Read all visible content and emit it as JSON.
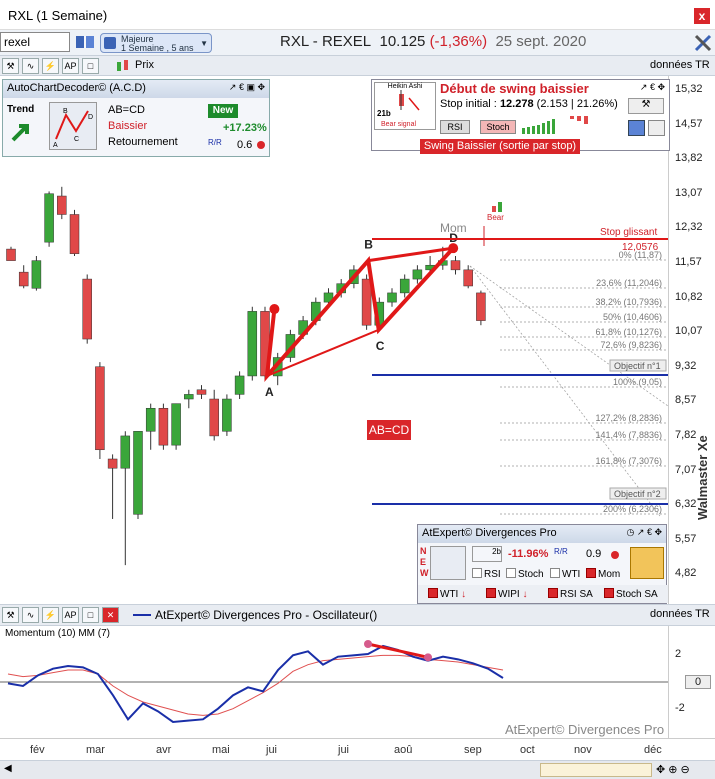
{
  "window": {
    "title": "RXL (1 Semaine)",
    "close_label": "x"
  },
  "toolbar": {
    "symbol": "rexel",
    "period_line1": "Majeure",
    "period_line2": "1 Semaine , 5 ans",
    "quote_name": "RXL - REXEL",
    "quote_price": "10.125",
    "quote_change": "(-1,36%)",
    "quote_date": "25 sept. 2020"
  },
  "chartbar": {
    "price_label": "Prix",
    "data_label": "données TR"
  },
  "y_axis": {
    "labels": [
      "15,32",
      "14,57",
      "13,82",
      "13,07",
      "12,32",
      "11,57",
      "10,82",
      "10,07",
      "9,32",
      "8,57",
      "7,82",
      "7,07",
      "6,32",
      "5,57",
      "4,82"
    ]
  },
  "brand": "Walmaster Xe",
  "acd": {
    "title": "AutoChartDecoder© (A.C.D)",
    "trend_label": "Trend",
    "pattern": "AB=CD",
    "direction": "Baissier",
    "type": "Retournement",
    "badge": "New",
    "change": "+17.23%",
    "rr": "0.6",
    "mini_letters": [
      "A",
      "B",
      "C",
      "D"
    ]
  },
  "swing": {
    "mini_title": "Heikin Ashi",
    "mini_label": "21b",
    "mini_signal": "Bear signal",
    "title": "Début de swing baissier",
    "stop_label": "Stop initial :",
    "stop_value": "12.278",
    "stop_extra": "(2.153 | 21.26%)",
    "btn_rsi": "RSI",
    "btn_stoch": "Stoch",
    "banner": "Swing Baissier (sortie par stop)"
  },
  "chart_labels": {
    "A": "A",
    "B": "B",
    "C": "C",
    "D": "D",
    "mom": "Mom",
    "bear": "Bear",
    "stop_glissant": "Stop glissant",
    "stop_value": "12,0576",
    "abcd": "AB=CD",
    "obj1": "Objectif n°1",
    "obj2": "Objectif n°2",
    "fibs": [
      "0% (11,87)",
      "23,6% (11,2046)",
      "38,2% (10,7936)",
      "50% (10,4606)",
      "61,8% (10,1276)",
      "72,6% (9,8236)",
      "100% (9,05)",
      "127,2% (8,2836)",
      "141,4% (7,8836)",
      "161,8% (7,3076)",
      "200% (6,2306)"
    ]
  },
  "divergences": {
    "title": "AtExpert© Divergences Pro",
    "side_letters": [
      "N",
      "E",
      "W"
    ],
    "pct": "-11.96%",
    "num": "0.9",
    "mini_label": "2b",
    "checks_top": [
      {
        "label": "RSI",
        "on": false
      },
      {
        "label": "Stoch",
        "on": false
      },
      {
        "label": "WTI",
        "on": false
      },
      {
        "label": "Mom",
        "on": true
      }
    ],
    "checks_bottom": [
      {
        "label": "WTI",
        "on": true
      },
      {
        "label": "WIPI",
        "on": true
      },
      {
        "label": "RSI SA",
        "on": true
      },
      {
        "label": "Stoch SA",
        "on": true
      }
    ]
  },
  "oscillator": {
    "title": "AtExpert© Divergences Pro - Oscillateur()",
    "data_label": "données TR",
    "momentum_label": "Momentum (10) MM (7)",
    "y_labels": [
      "2",
      "0",
      "-2"
    ],
    "watermark": "AtExpert© Divergences Pro"
  },
  "x_axis": {
    "labels": [
      "fév",
      "mar",
      "avr",
      "mai",
      "jui",
      "jui",
      "aoû",
      "sep",
      "oct",
      "nov",
      "déc"
    ]
  },
  "colors": {
    "up": "#3aa63a",
    "down": "#e04848",
    "pattern": "#e01818",
    "target": "#1a2fa8",
    "momentum": "#1a2fa8",
    "signal": "#e05050"
  },
  "chart_data": {
    "type": "candlestick",
    "y_range": [
      4.82,
      15.32
    ],
    "candles": [
      {
        "o": 11.85,
        "h": 11.9,
        "l": 11.7,
        "c": 11.6
      },
      {
        "o": 11.35,
        "h": 11.5,
        "l": 11.0,
        "c": 11.05
      },
      {
        "o": 11.0,
        "h": 11.7,
        "l": 10.95,
        "c": 11.6
      },
      {
        "o": 12.0,
        "h": 13.1,
        "l": 11.9,
        "c": 13.05
      },
      {
        "o": 13.0,
        "h": 13.2,
        "l": 12.5,
        "c": 12.6
      },
      {
        "o": 12.6,
        "h": 12.7,
        "l": 11.7,
        "c": 11.75
      },
      {
        "o": 11.2,
        "h": 11.3,
        "l": 9.8,
        "c": 9.9
      },
      {
        "o": 9.3,
        "h": 9.4,
        "l": 7.3,
        "c": 7.5
      },
      {
        "o": 7.3,
        "h": 7.4,
        "l": 6.0,
        "c": 7.1
      },
      {
        "o": 7.1,
        "h": 7.9,
        "l": 5.0,
        "c": 7.8
      },
      {
        "o": 6.1,
        "h": 7.9,
        "l": 6.0,
        "c": 7.9
      },
      {
        "o": 7.9,
        "h": 8.5,
        "l": 7.5,
        "c": 8.4
      },
      {
        "o": 8.4,
        "h": 8.5,
        "l": 7.5,
        "c": 7.6
      },
      {
        "o": 7.6,
        "h": 8.5,
        "l": 7.5,
        "c": 8.5
      },
      {
        "o": 8.6,
        "h": 8.8,
        "l": 8.4,
        "c": 8.7
      },
      {
        "o": 8.8,
        "h": 8.9,
        "l": 8.6,
        "c": 8.7
      },
      {
        "o": 8.6,
        "h": 8.8,
        "l": 7.7,
        "c": 7.8
      },
      {
        "o": 7.9,
        "h": 8.7,
        "l": 7.8,
        "c": 8.6
      },
      {
        "o": 8.7,
        "h": 9.2,
        "l": 8.6,
        "c": 9.1
      },
      {
        "o": 9.1,
        "h": 10.6,
        "l": 9.0,
        "c": 10.5
      },
      {
        "o": 10.5,
        "h": 10.6,
        "l": 9.0,
        "c": 9.1
      },
      {
        "o": 9.1,
        "h": 9.6,
        "l": 8.9,
        "c": 9.5
      },
      {
        "o": 9.5,
        "h": 10.1,
        "l": 9.4,
        "c": 10.0
      },
      {
        "o": 10.0,
        "h": 10.4,
        "l": 9.9,
        "c": 10.3
      },
      {
        "o": 10.3,
        "h": 10.8,
        "l": 10.2,
        "c": 10.7
      },
      {
        "o": 10.7,
        "h": 11.0,
        "l": 10.6,
        "c": 10.9
      },
      {
        "o": 10.9,
        "h": 11.2,
        "l": 10.8,
        "c": 11.1
      },
      {
        "o": 11.1,
        "h": 11.5,
        "l": 11.0,
        "c": 11.4
      },
      {
        "o": 11.2,
        "h": 11.3,
        "l": 10.1,
        "c": 10.2
      },
      {
        "o": 10.2,
        "h": 10.8,
        "l": 10.1,
        "c": 10.7
      },
      {
        "o": 10.7,
        "h": 11.0,
        "l": 10.6,
        "c": 10.9
      },
      {
        "o": 10.9,
        "h": 11.3,
        "l": 10.8,
        "c": 11.2
      },
      {
        "o": 11.2,
        "h": 11.5,
        "l": 11.1,
        "c": 11.4
      },
      {
        "o": 11.4,
        "h": 11.7,
        "l": 11.3,
        "c": 11.5
      },
      {
        "o": 11.5,
        "h": 11.9,
        "l": 11.4,
        "c": 11.6
      },
      {
        "o": 11.6,
        "h": 11.7,
        "l": 11.3,
        "c": 11.4
      },
      {
        "o": 11.4,
        "h": 11.5,
        "l": 11.0,
        "c": 11.05
      },
      {
        "o": 10.9,
        "h": 10.95,
        "l": 10.2,
        "c": 10.3
      }
    ],
    "pattern_points": {
      "A": 9.1,
      "B": 11.6,
      "C": 10.1,
      "D": 11.87
    },
    "momentum": [
      -0.1,
      -0.3,
      0.5,
      1.0,
      1.2,
      1.1,
      0.6,
      -1.0,
      -2.8,
      -1.6,
      -2.2,
      -3.0,
      -2.9,
      -2.8,
      -2.0,
      -1.0,
      -0.4,
      -0.7,
      0.9,
      2.0,
      2.3,
      1.3,
      1.9,
      2.0,
      2.1,
      2.7,
      2.4,
      1.9,
      1.6,
      1.9,
      1.7,
      1.4,
      1.0,
      0.3
    ],
    "signal": [
      0.6,
      0.4,
      0.5,
      0.7,
      0.9,
      0.9,
      0.6,
      -0.3,
      -1.0,
      -1.5,
      -1.8,
      -2.1,
      -2.4,
      -2.5,
      -2.4,
      -2.0,
      -1.4,
      -0.8,
      -0.1,
      0.8,
      1.3,
      1.6,
      1.7,
      1.8,
      1.9,
      2.0,
      2.0,
      1.9,
      1.7,
      1.6,
      1.5,
      1.3,
      1.1,
      0.9
    ],
    "osc_y_range": [
      -3.6,
      3.6
    ]
  }
}
